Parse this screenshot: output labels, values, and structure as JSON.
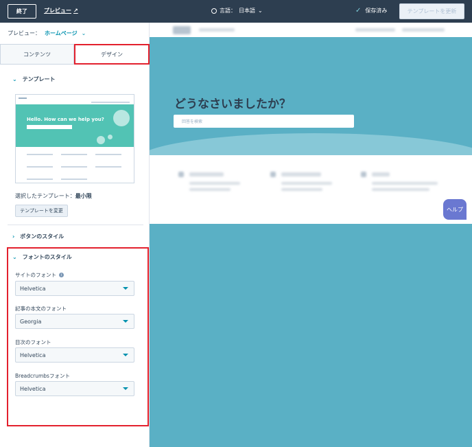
{
  "topbar": {
    "exit_label": "終了",
    "preview_label": "プレビュー",
    "language_label": "言語：",
    "language_value": "日本語",
    "saved_label": "保存済み",
    "update_button": "テンプレートを更新"
  },
  "sidebar": {
    "preview_label": "プレビュー：",
    "preview_value": "ホームページ",
    "tabs": [
      {
        "label": "コンテンツ",
        "active": false
      },
      {
        "label": "デザイン",
        "active": true
      }
    ],
    "template_section": {
      "title": "テンプレート",
      "thumbnail_hero_text": "Hello. How can we help you?",
      "selected_label": "選択したテンプレート：",
      "selected_value": "最小限",
      "change_button": "テンプレートを変更"
    },
    "button_style_section": {
      "title": "ボタンのスタイル"
    },
    "font_style_section": {
      "title": "フォントのスタイル",
      "fields": [
        {
          "label": "サイトのフォント",
          "value": "Helvetica"
        },
        {
          "label": "記事の本文のフォント",
          "value": "Georgia"
        },
        {
          "label": "目次のフォント",
          "value": "Helvetica"
        },
        {
          "label": "Breadcrumbsフォント",
          "value": "Helvetica"
        }
      ]
    }
  },
  "preview": {
    "hero_title": "どうなさいましたか？",
    "search_placeholder": "回答を検索",
    "help_button": "ヘルプ"
  },
  "colors": {
    "topbar": "#2d3e50",
    "accent": "#0091ae",
    "highlight": "#e3202d",
    "hero": "#5ab0c5",
    "help": "#6a78d1"
  }
}
